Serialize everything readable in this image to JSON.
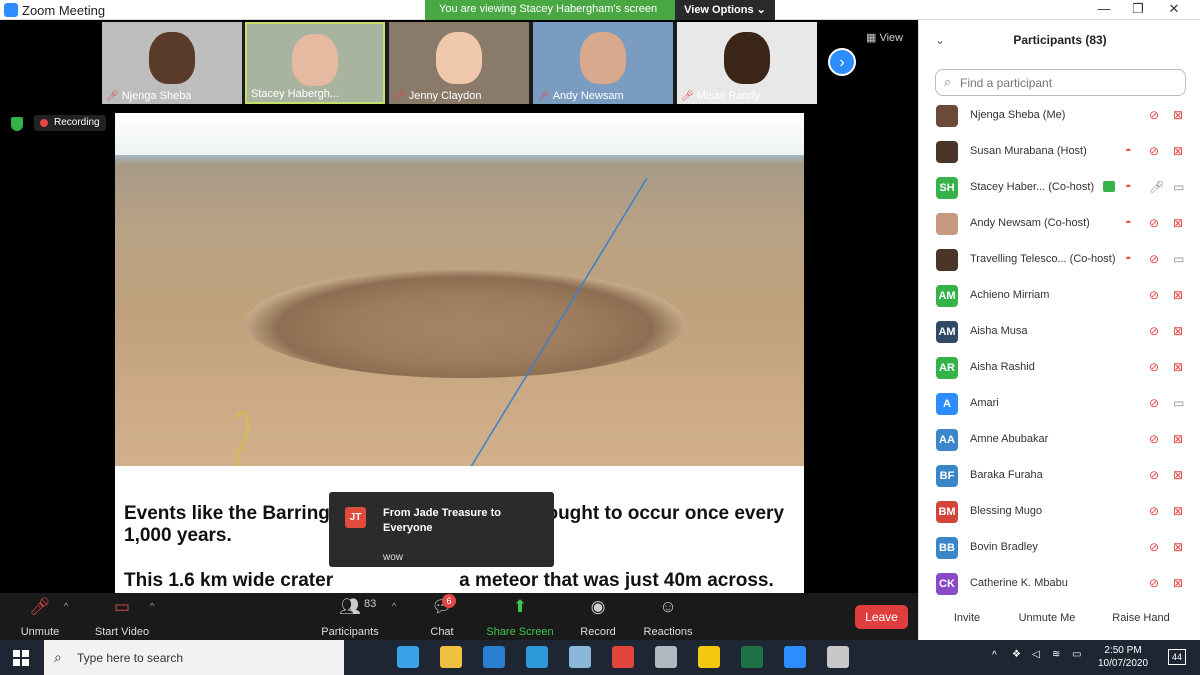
{
  "window": {
    "title": "Zoom Meeting",
    "icon": "zoom-icon",
    "controls": [
      "—",
      "❐",
      "✕"
    ]
  },
  "banner": {
    "text": "You are viewing Stacey Habergham's screen",
    "view_options": "View Options ⌄"
  },
  "thumbnails": [
    {
      "name": "Njenga Sheba",
      "muted": true,
      "skin": "#5a3a28",
      "bg": "#bdbdbd"
    },
    {
      "name": "Stacey Habergh...",
      "muted": false,
      "skin": "#e6b9a1",
      "bg": "#a8b3a0"
    },
    {
      "name": "Jenny Claydon",
      "muted": true,
      "skin": "#f0c9ad",
      "bg": "#8a7a6a"
    },
    {
      "name": "Andy Newsam",
      "muted": true,
      "skin": "#d8a98d",
      "bg": "#7a9cc0"
    },
    {
      "name": "Misati Randy",
      "muted": true,
      "skin": "#3b2418",
      "bg": "#e8e8e8"
    }
  ],
  "view_label": "View",
  "recording_label": "Recording",
  "slide": {
    "line1a": "Events like the Barringe",
    "line1b": "ought to occur once every",
    "line2": "1,000 years.",
    "line3a": "This 1.6 km wide crater",
    "line3b": "a meteor that was just 40m across."
  },
  "chat_popup": {
    "initials": "JT",
    "from": "From Jade Treasure to Everyone",
    "message": "wow"
  },
  "toolbar": {
    "unmute": "Unmute",
    "start_video": "Start Video",
    "participants": "Participants",
    "participants_count": "83",
    "chat": "Chat",
    "chat_badge": "6",
    "share_screen": "Share Screen",
    "record": "Record",
    "reactions": "Reactions",
    "leave": "Leave"
  },
  "panel": {
    "title": "Participants (83)",
    "search_placeholder": "Find a participant",
    "participants": [
      {
        "initials": "",
        "name": "Njenga Sheba (Me)",
        "color": "#6b4a3a",
        "hand": false,
        "mic_on": false,
        "video_on": false,
        "sharing": false
      },
      {
        "initials": "",
        "name": "Susan Murabana (Host)",
        "color": "#4a3528",
        "hand": true,
        "mic_on": false,
        "video_on": false,
        "sharing": false
      },
      {
        "initials": "SH",
        "name": "Stacey Haber... (Co-host)",
        "color": "#35b34a",
        "hand": true,
        "mic_on": true,
        "video_on": true,
        "sharing": true
      },
      {
        "initials": "",
        "name": "Andy Newsam (Co-host)",
        "color": "#c79a80",
        "hand": true,
        "mic_on": false,
        "video_on": false,
        "sharing": false
      },
      {
        "initials": "",
        "name": "Travelling Telesco... (Co-host)",
        "color": "#4a3528",
        "hand": true,
        "mic_on": false,
        "video_on": true,
        "sharing": false
      },
      {
        "initials": "AM",
        "name": "Achieno Mirriam",
        "color": "#35b34a",
        "hand": false,
        "mic_on": false,
        "video_on": false,
        "sharing": false
      },
      {
        "initials": "AM",
        "name": "Aisha Musa",
        "color": "#2f4a66",
        "hand": false,
        "mic_on": false,
        "video_on": false,
        "sharing": false
      },
      {
        "initials": "AR",
        "name": "Aisha Rashid",
        "color": "#35b34a",
        "hand": false,
        "mic_on": false,
        "video_on": false,
        "sharing": false
      },
      {
        "initials": "A",
        "name": "Amari",
        "color": "#2d8cff",
        "hand": false,
        "mic_on": false,
        "video_on": true,
        "sharing": false
      },
      {
        "initials": "AA",
        "name": "Amne Abubakar",
        "color": "#3a86c8",
        "hand": false,
        "mic_on": false,
        "video_on": false,
        "sharing": false
      },
      {
        "initials": "BF",
        "name": "Baraka Furaha",
        "color": "#3a86c8",
        "hand": false,
        "mic_on": false,
        "video_on": false,
        "sharing": false
      },
      {
        "initials": "BM",
        "name": "Blessing Mugo",
        "color": "#d0443c",
        "hand": false,
        "mic_on": false,
        "video_on": false,
        "sharing": false
      },
      {
        "initials": "BB",
        "name": "Bovin Bradley",
        "color": "#3a86c8",
        "hand": false,
        "mic_on": false,
        "video_on": false,
        "sharing": false
      },
      {
        "initials": "CK",
        "name": "Catherine K. Mbabu",
        "color": "#8a4ac8",
        "hand": false,
        "mic_on": false,
        "video_on": false,
        "sharing": false
      }
    ],
    "invite": "Invite",
    "unmute_me": "Unmute Me",
    "raise_hand": "Raise Hand"
  },
  "taskbar": {
    "search_placeholder": "Type here to search",
    "apps": [
      {
        "icon": "task-view-icon",
        "color": "#1d2632"
      },
      {
        "icon": "tablet-app-icon",
        "color": "#3aa0e8"
      },
      {
        "icon": "file-explorer-icon",
        "color": "#f0c040"
      },
      {
        "icon": "mail-icon",
        "color": "#2a7fd0"
      },
      {
        "icon": "photos-icon",
        "color": "#2d9ad8"
      },
      {
        "icon": "pen-app-icon",
        "color": "#8ab8d8"
      },
      {
        "icon": "chrome-icon",
        "color": "#e0443a"
      },
      {
        "icon": "scanner-icon",
        "color": "#b0b8c0"
      },
      {
        "icon": "power-bi-icon",
        "color": "#f2c811"
      },
      {
        "icon": "excel-icon",
        "color": "#1e7145"
      },
      {
        "icon": "zoom-icon",
        "color": "#2d8cff"
      },
      {
        "icon": "app-icon",
        "color": "#c8c8c8"
      }
    ],
    "time": "2:50 PM",
    "date": "10/07/2020",
    "notifications": "44"
  }
}
